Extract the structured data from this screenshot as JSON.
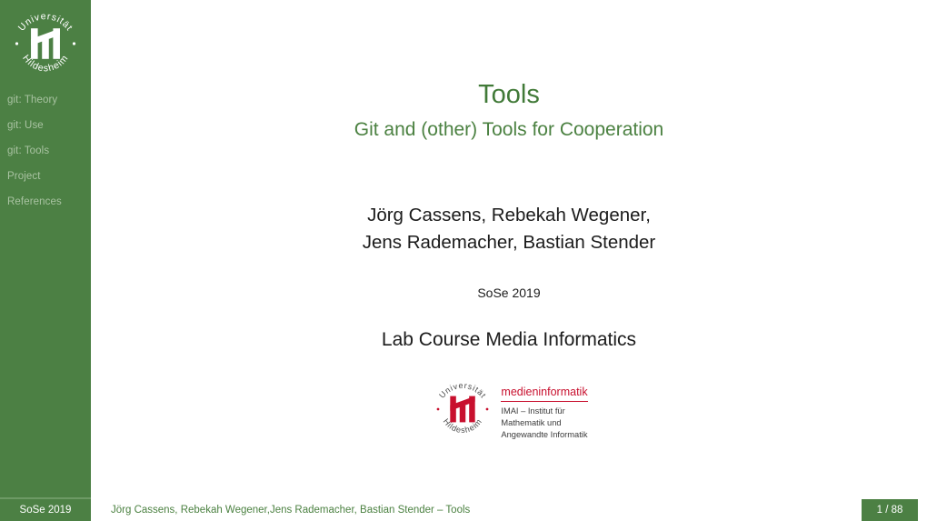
{
  "colors": {
    "sidebar_green": "#4c8044",
    "title_green": "#417a38",
    "subtitle_green": "#4b8141",
    "nav_text_green": "#a9c3a2",
    "institute_red": "#c8102e",
    "body_black": "#1b1b1b"
  },
  "sidebar": {
    "logo": {
      "name": "university-hildesheim-seal-logo",
      "arc_top": "Universität",
      "arc_bottom": "Hildesheim",
      "monogram": "H"
    },
    "items": [
      {
        "label": "git: Theory"
      },
      {
        "label": "git: Use"
      },
      {
        "label": "git: Tools"
      },
      {
        "label": "Project"
      },
      {
        "label": "References"
      }
    ]
  },
  "main": {
    "title": "Tools",
    "subtitle": "Git and (other) Tools for Cooperation",
    "authors": [
      "Jörg Cassens, Rebekah Wegener,",
      "Jens Rademacher, Bastian Stender"
    ],
    "date": "SoSe 2019",
    "course": "Lab Course Media Informatics",
    "institute": {
      "logo": {
        "name": "university-hildesheim-seal-logo-red",
        "arc_top": "Universität",
        "arc_bottom": "Hildesheim",
        "monogram": "H"
      },
      "brand": "medieninformatik",
      "lines": [
        "IMAI – Institut für",
        "Mathematik und",
        "Angewandte Informatik"
      ]
    }
  },
  "footer": {
    "date": "SoSe 2019",
    "center": "Jörg Cassens, Rebekah Wegener,Jens Rademacher, Bastian Stender – Tools",
    "page": "1 / 88"
  }
}
